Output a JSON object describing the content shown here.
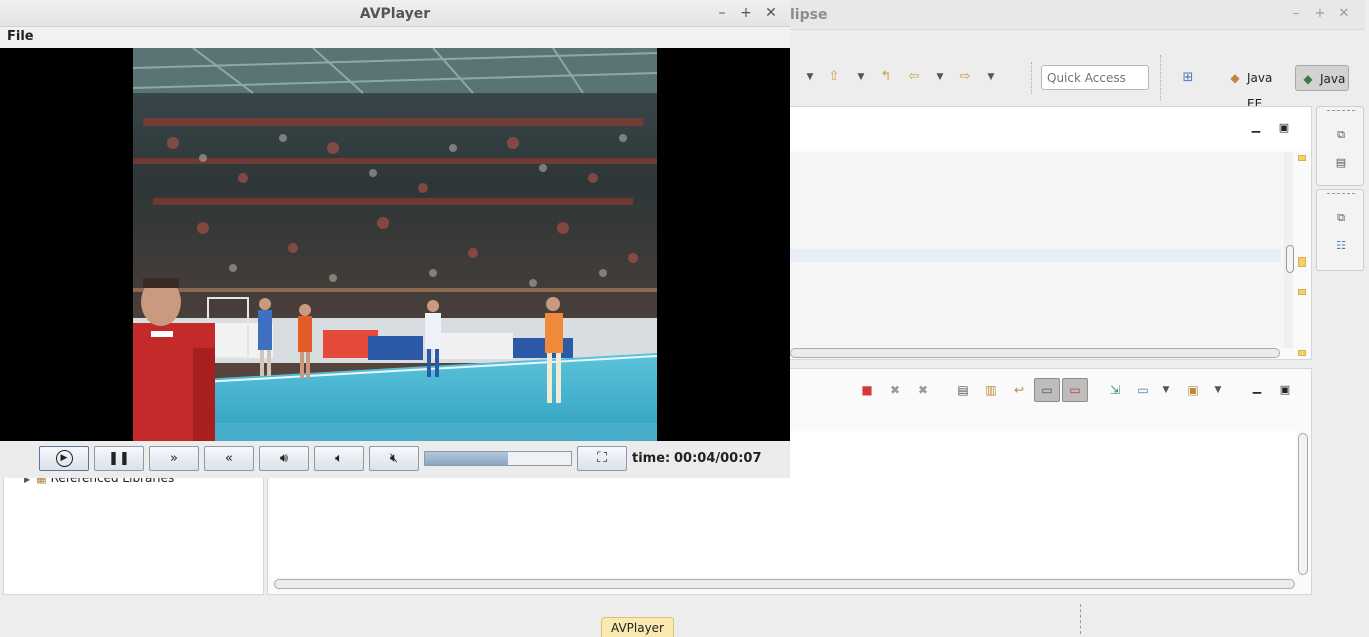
{
  "eclipse": {
    "title_fragment": "lipse",
    "quick_access_placeholder": "Quick Access",
    "perspectives": [
      {
        "label": "Java EE"
      },
      {
        "label": "Java"
      }
    ],
    "package_explorer": {
      "item_label": "Referenced Libraries"
    },
    "status_bar": {
      "task_label": "AVPlayer"
    }
  },
  "avplayer": {
    "title": "AVPlayer",
    "menu": [
      "File"
    ],
    "controls": {
      "play": "play",
      "pause": "pause",
      "forward": "forward",
      "rewind": "rewind",
      "volume_up": "volume up",
      "volume_down": "volume down",
      "mute": "mute",
      "fullscreen": "fullscreen"
    },
    "progress_fraction": 0.57,
    "time_label": "time:",
    "time_value": "00:04/00:07"
  },
  "colors": {
    "video_background": "#000000",
    "court": "#46b5d1",
    "accent_java": "#d2d2d2",
    "task_tab": "#fbeab0"
  }
}
